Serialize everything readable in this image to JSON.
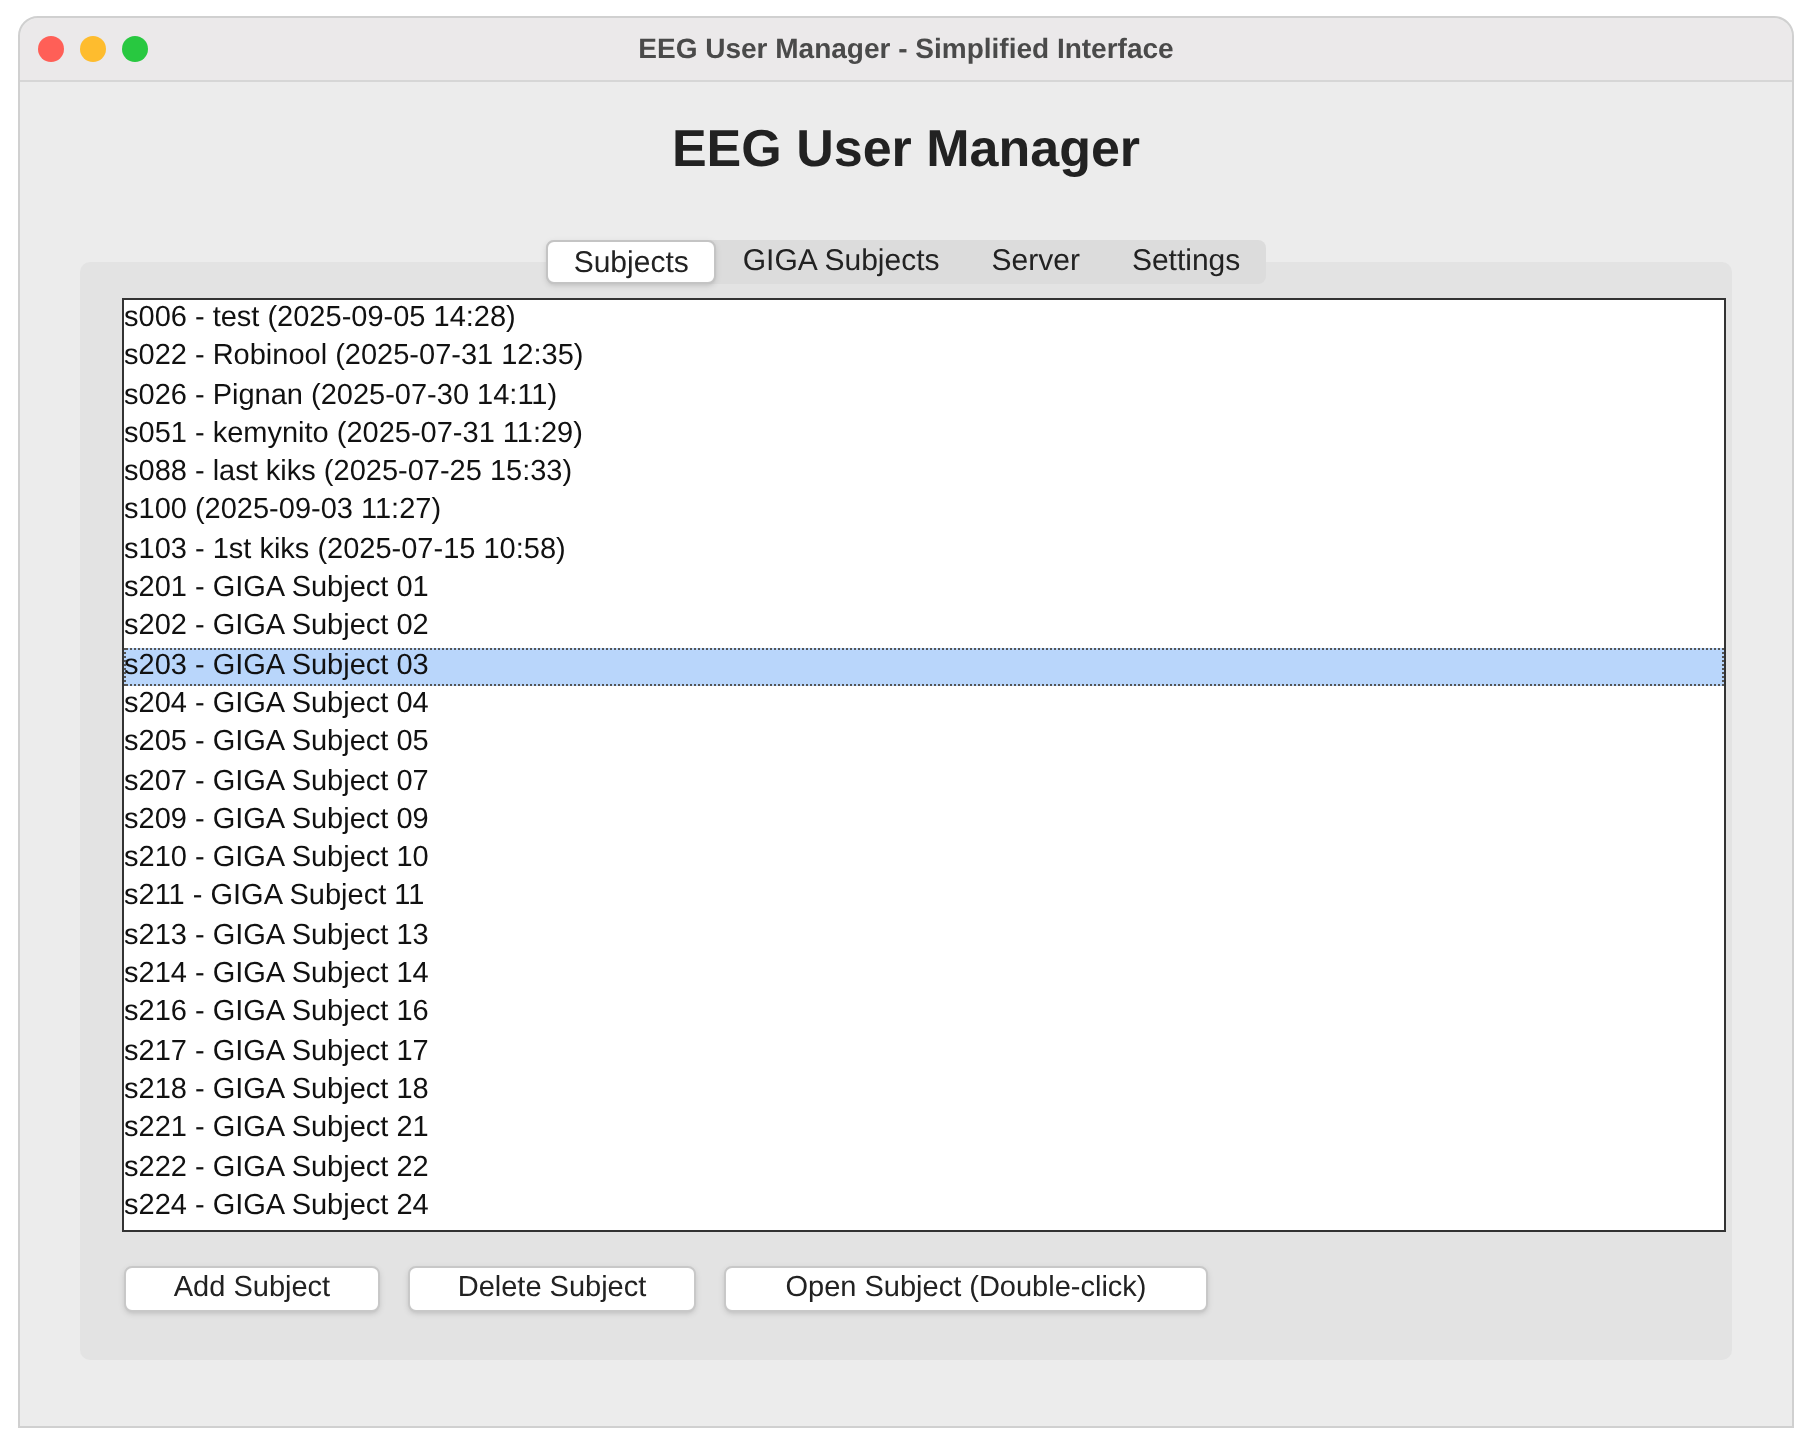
{
  "window": {
    "title": "EEG User Manager - Simplified Interface"
  },
  "heading": "EEG User Manager",
  "tabs": [
    {
      "label": "Subjects",
      "selected": true
    },
    {
      "label": "GIGA Subjects",
      "selected": false
    },
    {
      "label": "Server",
      "selected": false
    },
    {
      "label": "Settings",
      "selected": false
    }
  ],
  "subjects": [
    {
      "label": "s006 - test (2025-09-05 14:28)",
      "selected": false
    },
    {
      "label": "s022 - Robinool (2025-07-31 12:35)",
      "selected": false
    },
    {
      "label": "s026 - Pignan (2025-07-30 14:11)",
      "selected": false
    },
    {
      "label": "s051 - kemynito (2025-07-31 11:29)",
      "selected": false
    },
    {
      "label": "s088 - last kiks (2025-07-25 15:33)",
      "selected": false
    },
    {
      "label": "s100 (2025-09-03 11:27)",
      "selected": false
    },
    {
      "label": "s103 - 1st kiks (2025-07-15 10:58)",
      "selected": false
    },
    {
      "label": "s201 - GIGA Subject 01",
      "selected": false
    },
    {
      "label": "s202 - GIGA Subject 02",
      "selected": false
    },
    {
      "label": "s203 - GIGA Subject 03",
      "selected": true
    },
    {
      "label": "s204 - GIGA Subject 04",
      "selected": false
    },
    {
      "label": "s205 - GIGA Subject 05",
      "selected": false
    },
    {
      "label": "s207 - GIGA Subject 07",
      "selected": false
    },
    {
      "label": "s209 - GIGA Subject 09",
      "selected": false
    },
    {
      "label": "s210 - GIGA Subject 10",
      "selected": false
    },
    {
      "label": "s211 - GIGA Subject 11",
      "selected": false
    },
    {
      "label": "s213 - GIGA Subject 13",
      "selected": false
    },
    {
      "label": "s214 - GIGA Subject 14",
      "selected": false
    },
    {
      "label": "s216 - GIGA Subject 16",
      "selected": false
    },
    {
      "label": "s217 - GIGA Subject 17",
      "selected": false
    },
    {
      "label": "s218 - GIGA Subject 18",
      "selected": false
    },
    {
      "label": "s221 - GIGA Subject 21",
      "selected": false
    },
    {
      "label": "s222 - GIGA Subject 22",
      "selected": false
    },
    {
      "label": "s224 - GIGA Subject 24",
      "selected": false
    }
  ],
  "buttons": [
    "Add Subject",
    "Delete Subject",
    "Open Subject (Double-click)"
  ]
}
